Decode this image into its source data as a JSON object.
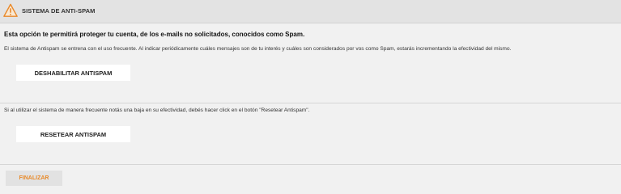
{
  "header": {
    "icon": "warning-icon",
    "title": "SISTEMA DE ANTI-SPAM",
    "icon_color": "#e8892b"
  },
  "main": {
    "intro": "Esta opción te permitirá proteger tu cuenta, de los e-mails no solicitados, conocidos como Spam.",
    "description": "El sistema de Antispam se entrena con el uso frecuente. Al indicar periódicamente cuáles mensajes son de tu interés y cuáles son considerados por vos como Spam, estarás incrementando la efectividad del mismo.",
    "disable_button_label": "DESHABILITAR ANTISPAM",
    "reset_note": "Si al utilizar el sistema de manera frecuente notás una baja en su efectividad, debés hacer click en el botón \"Resetear Antispam\".",
    "reset_button_label": "RESETEAR ANTISPAM"
  },
  "footer": {
    "finish_button_label": "FINALIZAR",
    "finish_color": "#e88a2a"
  }
}
